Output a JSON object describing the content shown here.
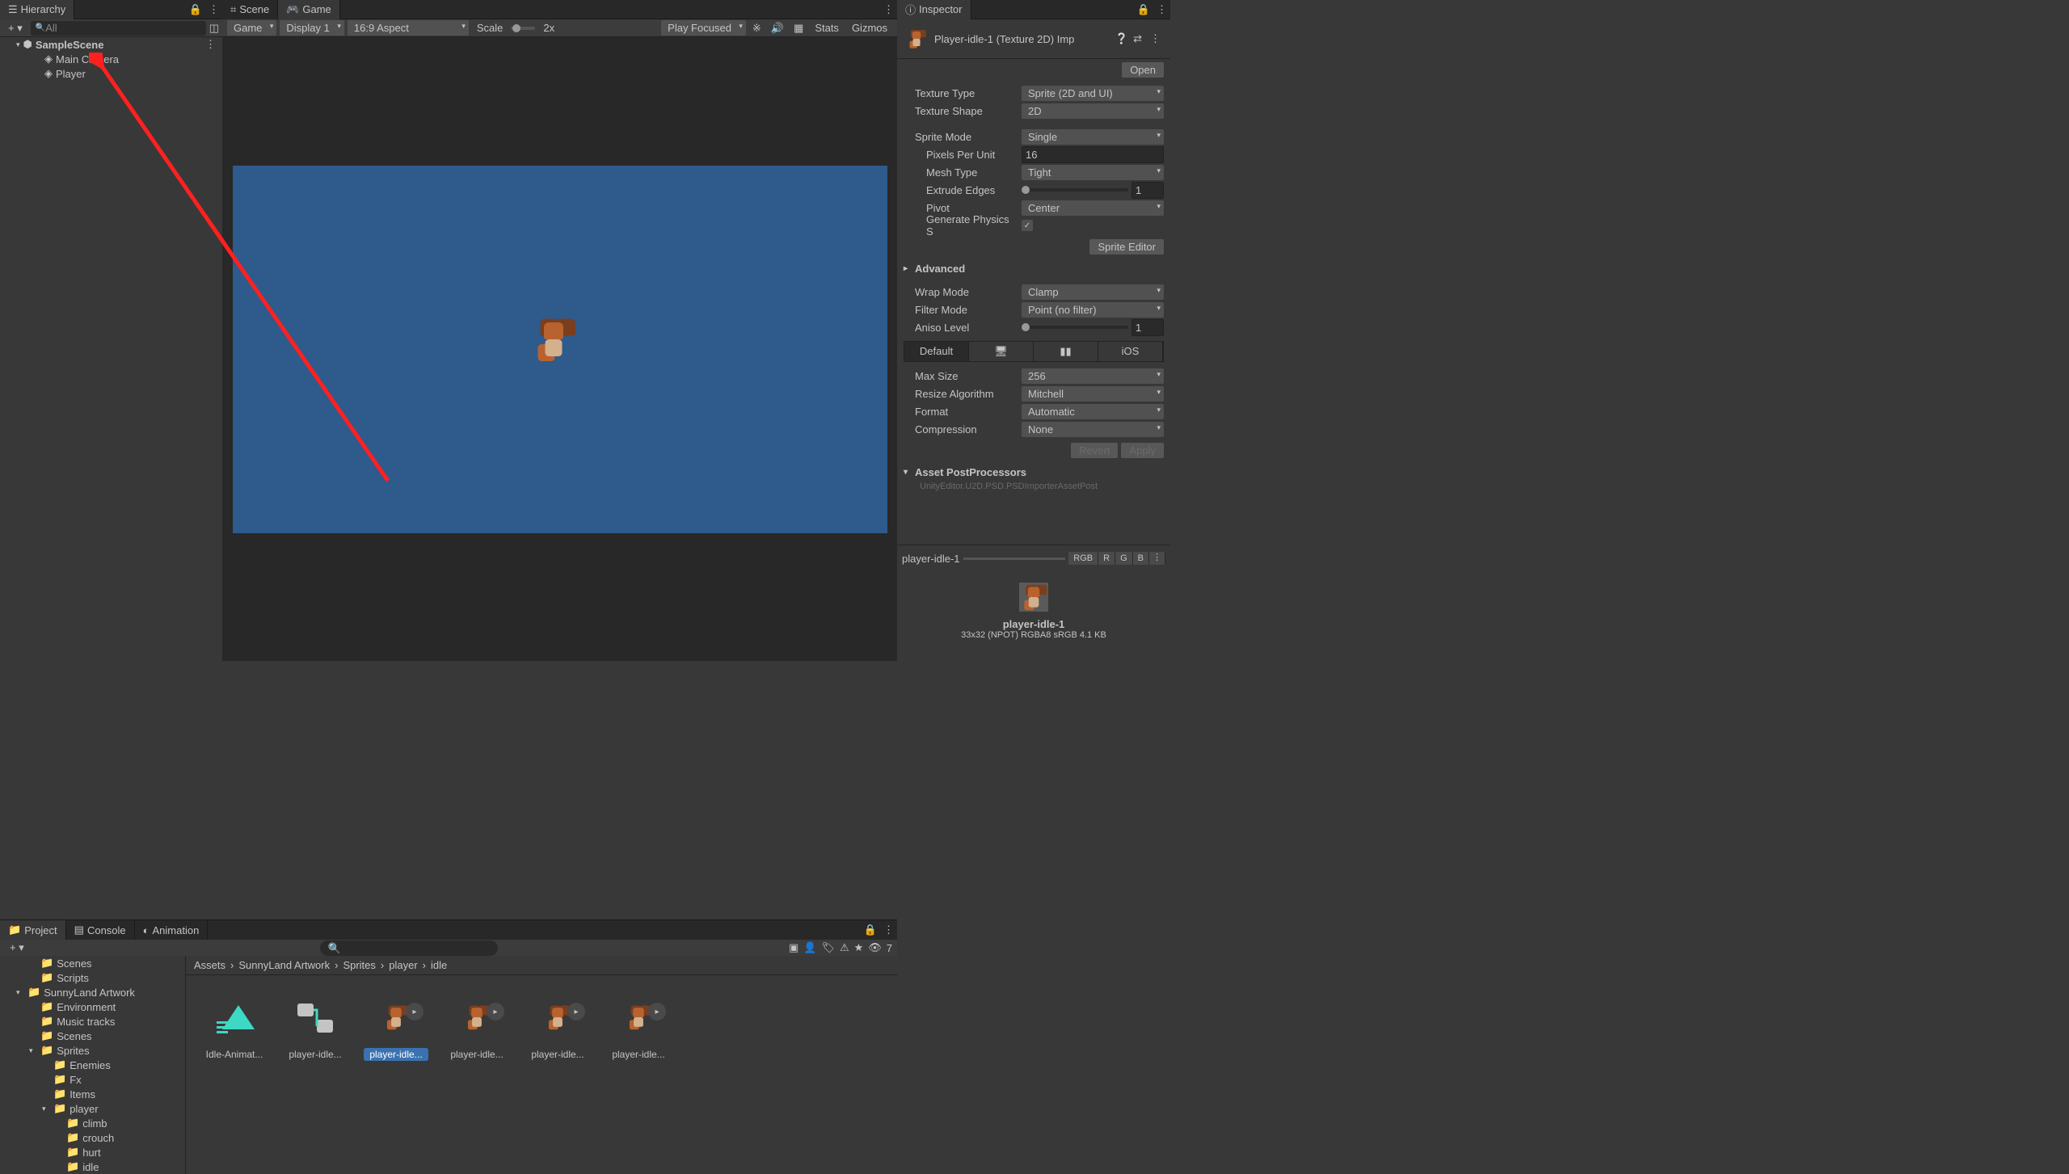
{
  "hierarchy": {
    "tab_label": "Hierarchy",
    "search_placeholder": "All",
    "scene": "SampleScene",
    "items": [
      "Main Camera",
      "Player"
    ]
  },
  "scene_tabs": {
    "scene": "Scene",
    "game": "Game"
  },
  "game_toolbar": {
    "mode": "Game",
    "display": "Display 1",
    "aspect": "16:9 Aspect",
    "scale_label": "Scale",
    "scale_value": "2x",
    "play_mode": "Play Focused",
    "stats": "Stats",
    "gizmos": "Gizmos"
  },
  "project": {
    "tabs": [
      "Project",
      "Console",
      "Animation"
    ],
    "hidden_count": "7",
    "tree": [
      {
        "label": "Scenes",
        "depth": 1
      },
      {
        "label": "Scripts",
        "depth": 1
      },
      {
        "label": "SunnyLand Artwork",
        "depth": 0,
        "open": true
      },
      {
        "label": "Environment",
        "depth": 1
      },
      {
        "label": "Music tracks",
        "depth": 1
      },
      {
        "label": "Scenes",
        "depth": 1
      },
      {
        "label": "Sprites",
        "depth": 1,
        "open": true
      },
      {
        "label": "Enemies",
        "depth": 2
      },
      {
        "label": "Fx",
        "depth": 2
      },
      {
        "label": "Items",
        "depth": 2
      },
      {
        "label": "player",
        "depth": 2,
        "open": true
      },
      {
        "label": "climb",
        "depth": 3
      },
      {
        "label": "crouch",
        "depth": 3
      },
      {
        "label": "hurt",
        "depth": 3
      },
      {
        "label": "idle",
        "depth": 3
      }
    ],
    "breadcrumb": [
      "Assets",
      "SunnyLand Artwork",
      "Sprites",
      "player",
      "idle"
    ],
    "assets": [
      {
        "name": "Idle-Animat...",
        "type": "anim"
      },
      {
        "name": "player-idle...",
        "type": "controller"
      },
      {
        "name": "player-idle...",
        "type": "sprite",
        "selected": true
      },
      {
        "name": "player-idle...",
        "type": "sprite"
      },
      {
        "name": "player-idle...",
        "type": "sprite"
      },
      {
        "name": "player-idle...",
        "type": "sprite"
      }
    ]
  },
  "inspector": {
    "tab_label": "Inspector",
    "asset_title": "Player-idle-1 (Texture 2D) Imp",
    "open_btn": "Open",
    "texture_type": {
      "label": "Texture Type",
      "value": "Sprite (2D and UI)"
    },
    "texture_shape": {
      "label": "Texture Shape",
      "value": "2D"
    },
    "sprite_mode": {
      "label": "Sprite Mode",
      "value": "Single"
    },
    "pixels_per_unit": {
      "label": "Pixels Per Unit",
      "value": "16"
    },
    "mesh_type": {
      "label": "Mesh Type",
      "value": "Tight"
    },
    "extrude_edges": {
      "label": "Extrude Edges",
      "value": "1"
    },
    "pivot": {
      "label": "Pivot",
      "value": "Center"
    },
    "generate_physics": {
      "label": "Generate Physics S"
    },
    "sprite_editor_btn": "Sprite Editor",
    "advanced": "Advanced",
    "wrap_mode": {
      "label": "Wrap Mode",
      "value": "Clamp"
    },
    "filter_mode": {
      "label": "Filter Mode",
      "value": "Point (no filter)"
    },
    "aniso_level": {
      "label": "Aniso Level",
      "value": "1"
    },
    "platforms": [
      "Default",
      "🖥",
      "▮▮",
      "iOS"
    ],
    "max_size": {
      "label": "Max Size",
      "value": "256"
    },
    "resize_algo": {
      "label": "Resize Algorithm",
      "value": "Mitchell"
    },
    "format": {
      "label": "Format",
      "value": "Automatic"
    },
    "compression": {
      "label": "Compression",
      "value": "None"
    },
    "revert": "Revert",
    "apply": "Apply",
    "asset_postprocessors": "Asset PostProcessors",
    "postproc_line": "UnityEditor.U2D.PSD.PSDImporterAssetPost",
    "preview_name": "player-idle-1",
    "channels": [
      "RGB",
      "R",
      "G",
      "B"
    ],
    "preview_label": "player-idle-1",
    "preview_info": "33x32 (NPOT)  RGBA8 sRGB  4.1 KB"
  }
}
